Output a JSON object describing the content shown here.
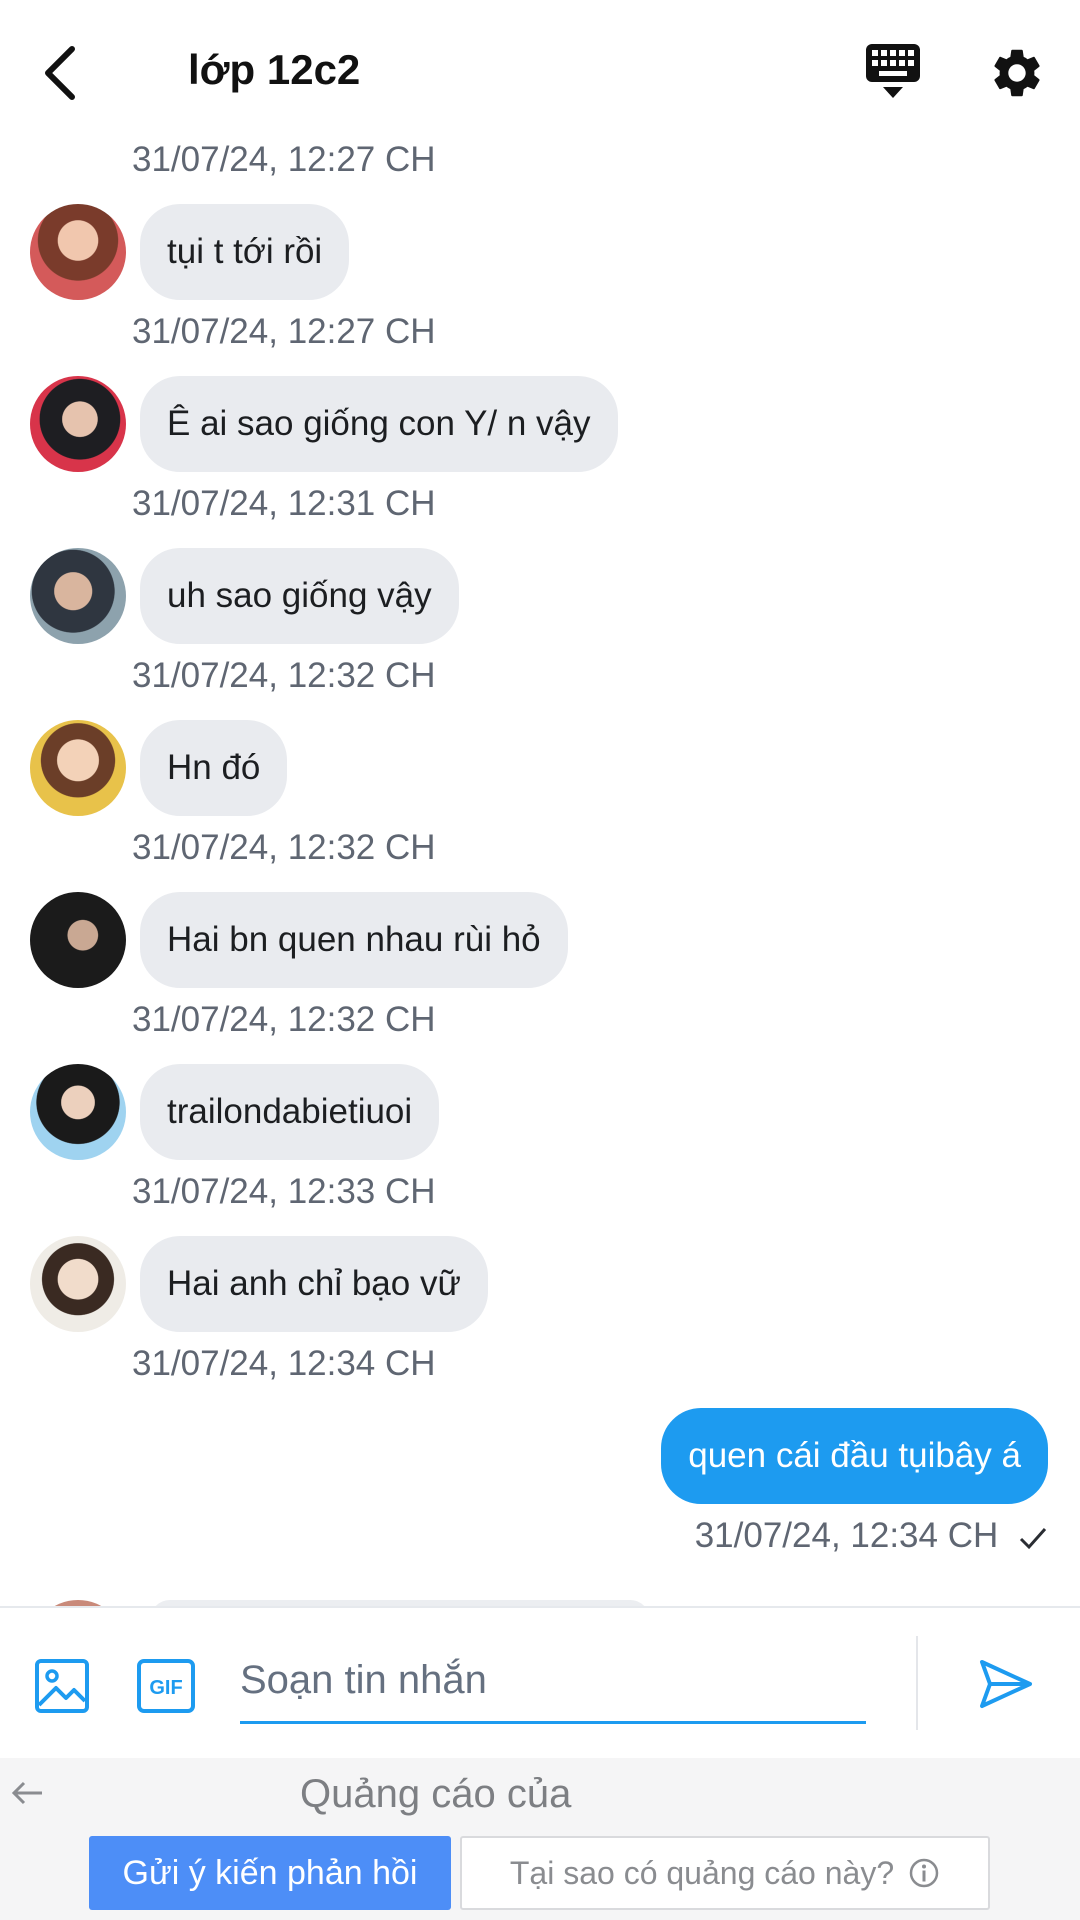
{
  "header": {
    "title": "lớp 12c2"
  },
  "messages": {
    "top_timestamp": "31/07/24, 12:27 CH",
    "incoming": [
      {
        "text": "tụi t tới rồi",
        "timestamp": "31/07/24, 12:27 CH"
      },
      {
        "text": "Ê ai sao giống con Y/ n vậy",
        "timestamp": "31/07/24, 12:31 CH"
      },
      {
        "text": "uh sao giống vậy",
        "timestamp": "31/07/24, 12:32 CH"
      },
      {
        "text": "Hn đó",
        "timestamp": "31/07/24, 12:32 CH"
      },
      {
        "text": "Hai bn quen nhau rùi hỏ",
        "timestamp": "31/07/24, 12:32 CH"
      },
      {
        "text": "trailondabietiuoi",
        "timestamp": "31/07/24, 12:33 CH"
      },
      {
        "text": "Hai anh chỉ bạo vữ",
        "timestamp": "31/07/24, 12:34 CH"
      }
    ],
    "outgoing": [
      {
        "text": "quen cái đầu tụibây á",
        "timestamp": "31/07/24, 12:34 CH"
      }
    ]
  },
  "composer": {
    "placeholder": "Soạn tin nhắn",
    "gif_label": "GIF"
  },
  "ad": {
    "title": "Quảng cáo của",
    "feedback_label": "Gửi ý kiến phản hồi",
    "why_label": "Tại sao có quảng cáo này?"
  },
  "colors": {
    "accent": "#1d9bf0",
    "incoming_bubble": "#e9ebef",
    "timestamp": "#5f6672",
    "ad_button": "#4d8ef7"
  },
  "icons": {
    "back": "chevron-left-icon",
    "keyboard": "keyboard-icon",
    "settings": "gear-icon",
    "image": "image-icon",
    "gif": "gif-icon",
    "send": "send-icon",
    "read": "check-icon",
    "info": "info-icon"
  }
}
